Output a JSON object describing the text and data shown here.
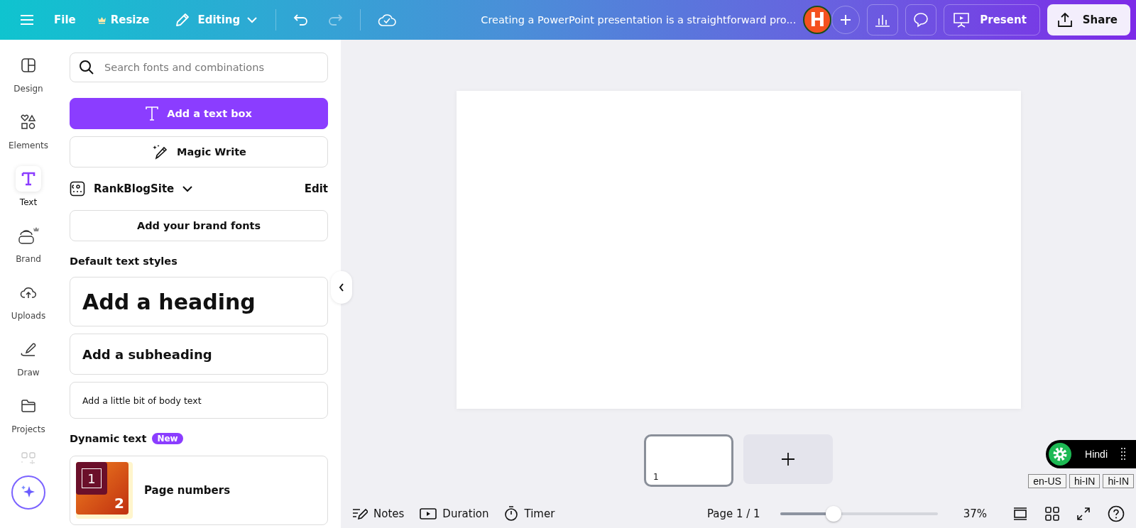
{
  "topbar": {
    "menu": [
      {
        "label": "File",
        "kind": "plain"
      },
      {
        "label": "Resize",
        "kind": "crown"
      }
    ],
    "mode": "Editing",
    "title": "Creating a PowerPoint presentation is a straightforward pro...",
    "avatar_letter": "H",
    "actions": [
      {
        "label": "Present"
      },
      {
        "label": "Share"
      }
    ]
  },
  "rail": [
    {
      "label": "Design",
      "kind": "design",
      "selected": false
    },
    {
      "label": "Elements",
      "kind": "elements",
      "selected": false
    },
    {
      "label": "Text",
      "kind": "text",
      "selected": true
    },
    {
      "label": "Brand",
      "kind": "brand",
      "selected": false
    },
    {
      "label": "Uploads",
      "kind": "uploads",
      "selected": false
    },
    {
      "label": "Draw",
      "kind": "draw",
      "selected": false
    },
    {
      "label": "Projects",
      "kind": "projects",
      "selected": false
    }
  ],
  "panel": {
    "search": {
      "placeholder": "Search fonts and combinations"
    },
    "add_text_box": "Add a text box",
    "magic_write": "Magic Write",
    "brand_kit": {
      "name": "RankBlogSite",
      "edit": "Edit"
    },
    "brand_fonts": "Add your brand fonts",
    "default_heading": "Default text styles",
    "styles": [
      {
        "label": "Add a heading",
        "kind": "heading"
      },
      {
        "label": "Add a subheading",
        "kind": "subheading"
      },
      {
        "label": "Add a little bit of body text",
        "kind": "body"
      }
    ],
    "dynamic": {
      "heading": "Dynamic text",
      "badge": "New",
      "items": [
        {
          "label": "Page numbers",
          "thumb_one": "1",
          "thumb_two": "2"
        }
      ]
    }
  },
  "pages": [
    {
      "number": "1",
      "selected": true
    }
  ],
  "footer": {
    "tools": [
      {
        "label": "Notes",
        "kind": "notes"
      },
      {
        "label": "Duration",
        "kind": "duration"
      },
      {
        "label": "Timer",
        "kind": "timer"
      }
    ],
    "page_indicator": "Page 1 / 1",
    "zoom": {
      "level": 0.34,
      "reading": "37%"
    }
  },
  "language_widget": {
    "label": "Hindi",
    "tags": [
      "en-US",
      "hi-IN",
      "hi-IN"
    ]
  }
}
